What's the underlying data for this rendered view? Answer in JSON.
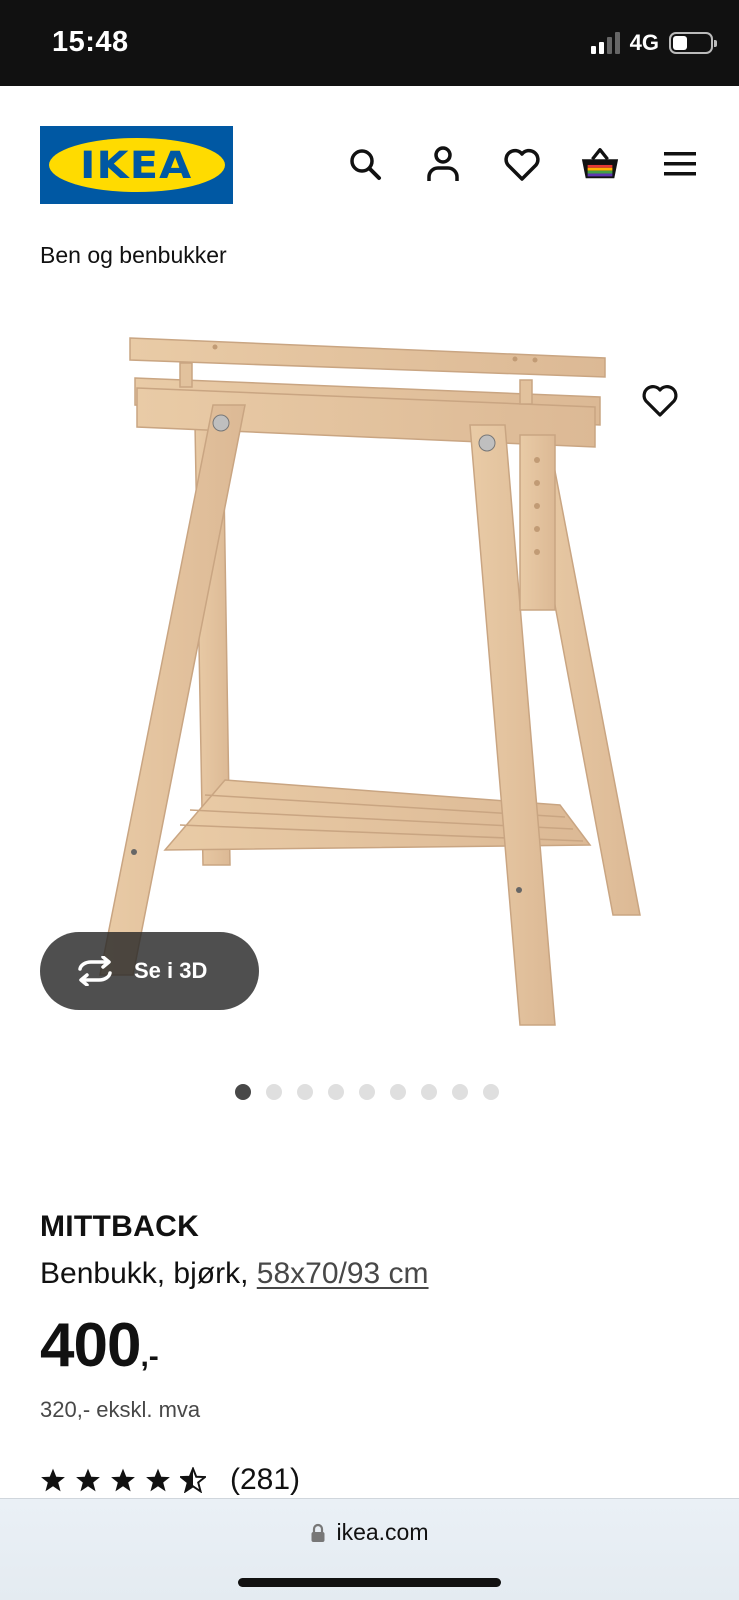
{
  "status_bar": {
    "time": "15:48",
    "network": "4G",
    "battery_level": 0.35,
    "icons": [
      "signal-icon",
      "battery-icon"
    ]
  },
  "header": {
    "logo_text": "IKEA",
    "icons": [
      "search-icon",
      "account-icon",
      "favourites-icon",
      "basket-icon",
      "menu-icon"
    ]
  },
  "breadcrumb": "Ben og benbukker",
  "gallery": {
    "see_3d_label": "Se i 3D",
    "image_count": 9,
    "active_index": 0
  },
  "product": {
    "name": "MITTBACK",
    "description": "Benbukk, bjørk,",
    "size": "58x70/93 cm",
    "price_integer": "400",
    "price_suffix": ",-",
    "price_excl_vat": "320,- ekskl. mva",
    "rating_stars": 4.5,
    "review_count": "(281)"
  },
  "browser": {
    "url": "ikea.com"
  },
  "colors": {
    "ikea_blue": "#0058a3",
    "ikea_yellow": "#ffdb00",
    "wood": "#e8c9a4"
  }
}
